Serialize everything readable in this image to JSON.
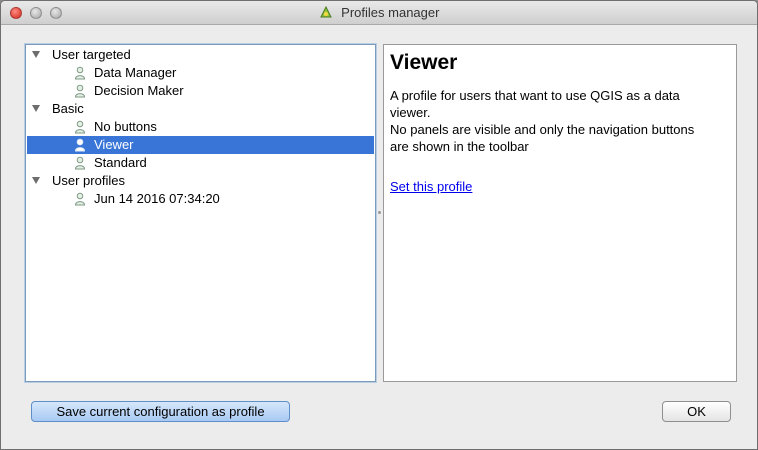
{
  "window": {
    "title": "Profiles manager"
  },
  "tree": {
    "groups": [
      {
        "label": "User targeted",
        "items": [
          {
            "label": "Data Manager"
          },
          {
            "label": "Decision Maker"
          }
        ]
      },
      {
        "label": "Basic",
        "items": [
          {
            "label": "No buttons"
          },
          {
            "label": "Viewer"
          },
          {
            "label": "Standard"
          }
        ]
      },
      {
        "label": "User profiles",
        "items": [
          {
            "label": "Jun 14 2016 07:34:20"
          }
        ]
      }
    ],
    "selected": "Viewer"
  },
  "detail": {
    "title": "Viewer",
    "description": "A profile for users that want to use QGIS as a data\nviewer.\nNo panels are visible and only the navigation buttons\nare shown in the toolbar",
    "set_link": "Set this profile"
  },
  "buttons": {
    "save_label": "Save current configuration as profile",
    "ok_label": "OK"
  },
  "colors": {
    "selection": "#3875d7",
    "link": "#0000ee"
  }
}
